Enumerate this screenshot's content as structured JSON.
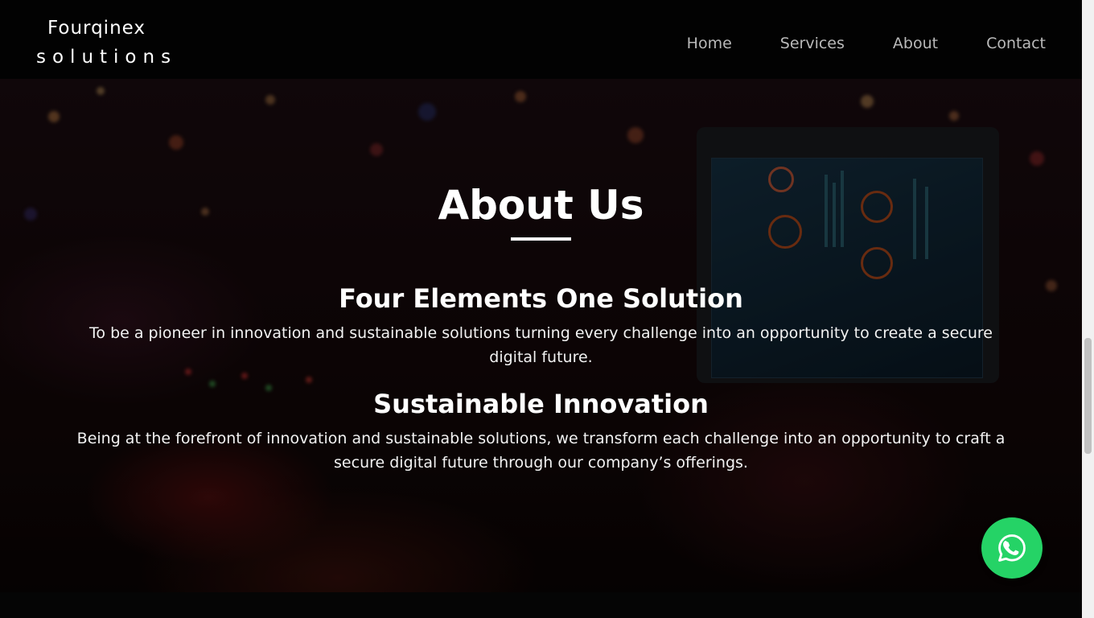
{
  "header": {
    "logo_line1": "Fourqinex",
    "logo_line2": "solutions",
    "nav": [
      {
        "label": "Home"
      },
      {
        "label": "Services"
      },
      {
        "label": "About"
      },
      {
        "label": "Contact"
      }
    ]
  },
  "about": {
    "title": "About Us",
    "sections": [
      {
        "heading": "Four Elements One Solution",
        "text": "To be a pioneer in innovation and sustainable solutions turning every challenge into an opportunity to create a secure digital future."
      },
      {
        "heading": "Sustainable Innovation",
        "text": "Being at the forefront of innovation and sustainable solutions, we transform each challenge into an opportunity to craft a secure digital future through our company’s offerings."
      }
    ]
  },
  "whatsapp": {
    "icon": "whatsapp-icon",
    "color": "#25d366"
  },
  "colors": {
    "nav_text": "#b9b9b9",
    "header_bg": "#020202"
  }
}
